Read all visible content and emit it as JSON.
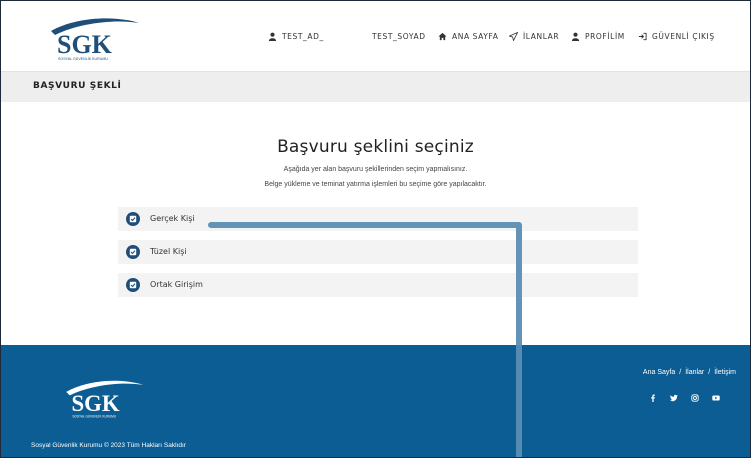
{
  "header": {
    "logo_text": "SGK",
    "logo_subtext": "SOSYAL GÜVENLİK KURUMU",
    "nav": {
      "user_first": "TEST_AD_",
      "user_last": "TEST_SOYAD",
      "home": "ANA SAYFA",
      "listings": "İLANLAR",
      "profile": "PROFİLİM",
      "logout": "GÜVENLİ ÇIKIŞ"
    }
  },
  "page": {
    "title": "BAŞVURU ŞEKLİ",
    "heading": "Başvuru şeklini seçiniz",
    "subtitle_1": "Aşağıda yer alan başvuru şekillerinden seçim yapmalısınız.",
    "subtitle_2": "Belge yükleme ve teminat yatırma işlemleri bu seçime göre yapılacaktır.",
    "options": [
      {
        "label": "Gerçek Kişi"
      },
      {
        "label": "Tüzel Kişi"
      },
      {
        "label": "Ortak Girişim"
      }
    ]
  },
  "footer": {
    "links": [
      "Ana Sayfa",
      "İlanlar",
      "İletişim"
    ],
    "separator": "/",
    "social_icons": [
      "facebook-icon",
      "twitter-icon",
      "instagram-icon",
      "youtube-icon"
    ],
    "copyright": "Sosyal Güvenlik Kurumu © 2023 Tüm Hakları Saklıdır"
  },
  "colors": {
    "brand_blue": "#1f4e7a",
    "footer_blue": "#0b5d93",
    "annotation_line": "#5b8db3"
  }
}
